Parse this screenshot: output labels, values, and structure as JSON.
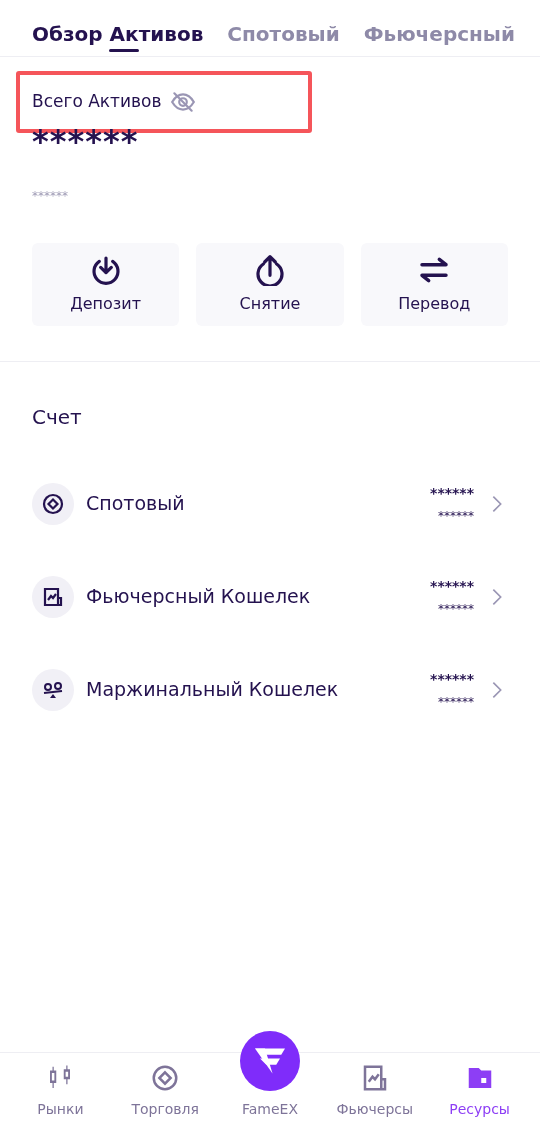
{
  "tabs": [
    {
      "label": "Обзор Активов",
      "selected": true
    },
    {
      "label": "Спотовый",
      "selected": false
    },
    {
      "label": "Фьючерсный",
      "selected": false
    }
  ],
  "total": {
    "label": "Всего Активов",
    "value": "******",
    "sub_value": "******",
    "highlighted": true
  },
  "actions": [
    {
      "label": "Депозит"
    },
    {
      "label": "Снятие"
    },
    {
      "label": "Перевод"
    }
  ],
  "accounts": {
    "title": "Счет",
    "items": [
      {
        "name": "Спотовый",
        "value": "******",
        "sub_value": "******"
      },
      {
        "name": "Фьючерсный Кошелек",
        "value": "******",
        "sub_value": "******"
      },
      {
        "name": "Маржинальный Кошелек",
        "value": "******",
        "sub_value": "******"
      }
    ]
  },
  "bottom_nav": [
    {
      "label": "Рынки",
      "kind": "tab",
      "selected": false
    },
    {
      "label": "Торговля",
      "kind": "tab",
      "selected": false
    },
    {
      "label": "FameEX",
      "kind": "center",
      "selected": false
    },
    {
      "label": "Фьючерсы",
      "kind": "tab",
      "selected": false
    },
    {
      "label": "Ресурсы",
      "kind": "tab",
      "selected": true
    }
  ]
}
